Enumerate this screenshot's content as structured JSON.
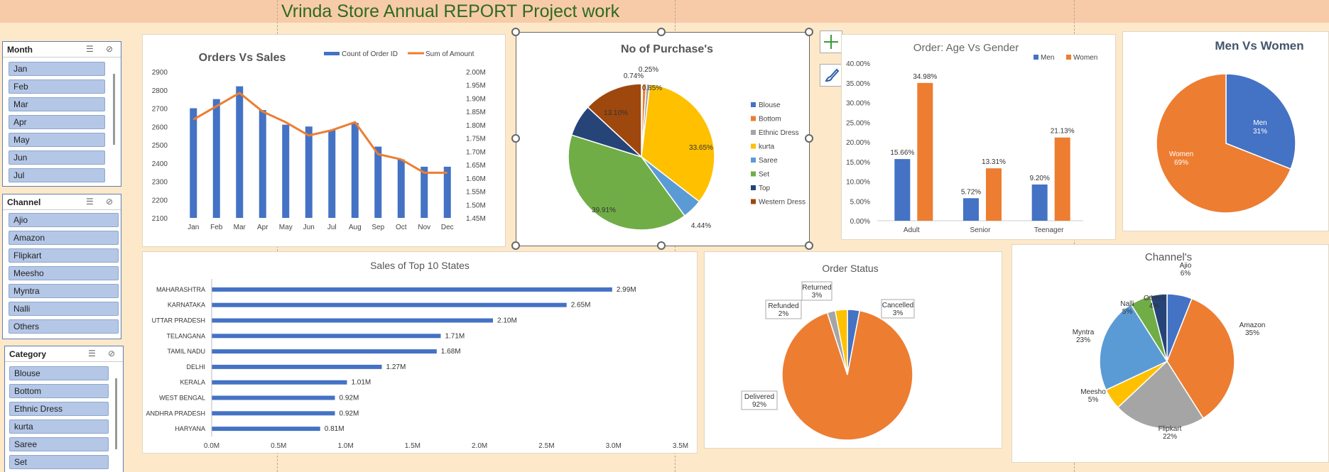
{
  "title": "Vrinda Store Annual REPORT Project work",
  "slicers": {
    "month": {
      "header": "Month",
      "items": [
        "Jan",
        "Feb",
        "Mar",
        "Apr",
        "May",
        "Jun",
        "Jul"
      ]
    },
    "channel": {
      "header": "Channel",
      "items": [
        "Ajio",
        "Amazon",
        "Flipkart",
        "Meesho",
        "Myntra",
        "Nalli",
        "Others"
      ]
    },
    "category": {
      "header": "Category",
      "items": [
        "Blouse",
        "Bottom",
        "Ethnic Dress",
        "kurta",
        "Saree",
        "Set"
      ]
    }
  },
  "sidebuttons": {
    "add_icon": "plus-icon",
    "style_icon": "brush-icon"
  },
  "chart_data": [
    {
      "type": "bar",
      "title": "Orders Vs Sales",
      "categories": [
        "Jan",
        "Feb",
        "Mar",
        "Apr",
        "May",
        "Jun",
        "Jul",
        "Aug",
        "Sep",
        "Oct",
        "Nov",
        "Dec"
      ],
      "series": [
        {
          "name": "Count of Order ID",
          "kind": "bar",
          "color": "#4472c4",
          "values": [
            2700,
            2750,
            2820,
            2690,
            2610,
            2600,
            2580,
            2620,
            2490,
            2420,
            2380,
            2380
          ]
        },
        {
          "name": "Sum of Amount",
          "kind": "line",
          "axis": "right",
          "color": "#ed7d31",
          "values": [
            1.82,
            1.87,
            1.92,
            1.85,
            1.81,
            1.76,
            1.78,
            1.81,
            1.69,
            1.67,
            1.62,
            1.62
          ]
        }
      ],
      "ylim": [
        2100,
        2900
      ],
      "ytick_labels": [
        "2900",
        "2800",
        "2700",
        "2600",
        "2500",
        "2400",
        "2300",
        "2200",
        "2100"
      ],
      "y2lim": [
        1.45,
        2.0
      ],
      "y2tick_labels": [
        "2.00M",
        "1.95M",
        "1.90M",
        "1.85M",
        "1.80M",
        "1.75M",
        "1.70M",
        "1.65M",
        "1.60M",
        "1.55M",
        "1.50M",
        "1.45M"
      ],
      "legend": "top-right"
    },
    {
      "type": "pie",
      "title": "No of Purchase's",
      "slices": [
        {
          "name": "Blouse",
          "value": 0.25,
          "label": "0.25%",
          "color": "#4472c4"
        },
        {
          "name": "Bottom",
          "value": 0.85,
          "label": "0.85%",
          "color": "#ed7d31"
        },
        {
          "name": "Ethnic Dress",
          "value": 0.74,
          "label": "0.74%",
          "color": "#a5a5a5"
        },
        {
          "name": "kurta",
          "value": 33.65,
          "label": "33.65%",
          "color": "#ffc000"
        },
        {
          "name": "Saree",
          "value": 4.44,
          "label": "4.44%",
          "color": "#5b9bd5"
        },
        {
          "name": "Set",
          "value": 39.91,
          "label": "39.91%",
          "color": "#70ad47"
        },
        {
          "name": "Top",
          "value": 7.06,
          "label": "",
          "color": "#264478"
        },
        {
          "name": "Western Dress",
          "value": 13.1,
          "label": "13.10%",
          "color": "#9e480e"
        }
      ],
      "legend": "right"
    },
    {
      "type": "bar",
      "title": "Order: Age Vs Gender",
      "categories": [
        "Adult",
        "Senior",
        "Teenager"
      ],
      "series": [
        {
          "name": "Men",
          "color": "#4472c4",
          "values": [
            15.66,
            5.72,
            9.2
          ],
          "labels": [
            "15.66%",
            "5.72%",
            "9.20%"
          ]
        },
        {
          "name": "Women",
          "color": "#ed7d31",
          "values": [
            34.98,
            13.31,
            21.13
          ],
          "labels": [
            "34.98%",
            "13.31%",
            "21.13%"
          ]
        }
      ],
      "ylim": [
        0,
        40
      ],
      "ytick_labels": [
        "40.00%",
        "35.00%",
        "30.00%",
        "25.00%",
        "20.00%",
        "15.00%",
        "10.00%",
        "5.00%",
        "0.00%"
      ],
      "legend": "top-right"
    },
    {
      "type": "pie",
      "title": "Men Vs Women",
      "slices": [
        {
          "name": "Men",
          "value": 31,
          "label": "31%",
          "color": "#4472c4"
        },
        {
          "name": "Women",
          "value": 69,
          "label": "69%",
          "color": "#ed7d31"
        }
      ]
    },
    {
      "type": "bar",
      "orientation": "horizontal",
      "title": "Sales of Top 10 States",
      "categories": [
        "MAHARASHTRA",
        "KARNATAKA",
        "UTTAR PRADESH",
        "TELANGANA",
        "TAMIL NADU",
        "DELHI",
        "KERALA",
        "WEST BENGAL",
        "ANDHRA PRADESH",
        "HARYANA"
      ],
      "values": [
        2.99,
        2.65,
        2.1,
        1.71,
        1.68,
        1.27,
        1.01,
        0.92,
        0.92,
        0.81
      ],
      "labels": [
        "2.99M",
        "2.65M",
        "2.10M",
        "1.71M",
        "1.68M",
        "1.27M",
        "1.01M",
        "0.92M",
        "0.92M",
        "0.81M"
      ],
      "xlim": [
        0,
        3.5
      ],
      "xtick_labels": [
        "0.0M",
        "0.5M",
        "1.0M",
        "1.5M",
        "2.0M",
        "2.5M",
        "3.0M",
        "3.5M"
      ],
      "color": "#4472c4"
    },
    {
      "type": "pie",
      "title": "Order Status",
      "slices": [
        {
          "name": "Cancelled",
          "value": 3,
          "label": "3%",
          "color": "#4472c4"
        },
        {
          "name": "Delivered",
          "value": 92,
          "label": "92%",
          "color": "#ed7d31"
        },
        {
          "name": "Refunded",
          "value": 2,
          "label": "2%",
          "color": "#a5a5a5"
        },
        {
          "name": "Returned",
          "value": 3,
          "label": "3%",
          "color": "#ffc000"
        }
      ]
    },
    {
      "type": "pie",
      "title": "Channel's",
      "slices": [
        {
          "name": "Ajio",
          "value": 6,
          "label": "6%",
          "color": "#4472c4"
        },
        {
          "name": "Amazon",
          "value": 35,
          "label": "35%",
          "color": "#ed7d31"
        },
        {
          "name": "Flipkart",
          "value": 22,
          "label": "22%",
          "color": "#a5a5a5"
        },
        {
          "name": "Meesho",
          "value": 5,
          "label": "5%",
          "color": "#ffc000"
        },
        {
          "name": "Myntra",
          "value": 23,
          "label": "23%",
          "color": "#5b9bd5"
        },
        {
          "name": "Nalli",
          "value": 5,
          "label": "5%",
          "color": "#70ad47"
        },
        {
          "name": "Others",
          "value": 4,
          "label": "4%",
          "color": "#264478"
        }
      ]
    }
  ]
}
